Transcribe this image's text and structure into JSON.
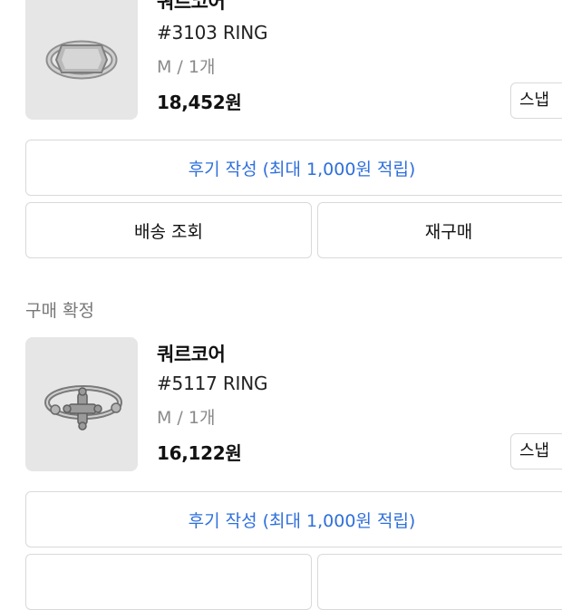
{
  "orders": [
    {
      "brand": "쿼르코어",
      "product_name": "#3103 RING",
      "option": "M / 1개",
      "price": "18,452원",
      "snap_label": "스냅 ",
      "thumbnail_icon": "signet-ring-icon",
      "review_label": "후기 작성 (최대 1,000원 적립)",
      "shipping_label": "배송 조회",
      "rebuy_label": "재구매"
    },
    {
      "status": "구매 확정",
      "brand": "쿼르코어",
      "product_name": "#5117 RING",
      "option": "M / 1개",
      "price": "16,122원",
      "snap_label": "스냅 ",
      "thumbnail_icon": "cross-ring-icon",
      "review_label": "후기 작성 (최대 1,000원 적립)"
    }
  ],
  "colors": {
    "accent": "#2f6fdb",
    "muted_text": "#8a8a8a",
    "thumbnail_bg": "#e6e6e6",
    "border": "#d9d9d9"
  }
}
